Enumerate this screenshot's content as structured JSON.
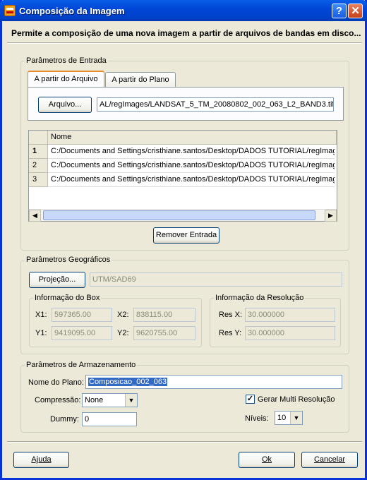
{
  "window": {
    "title": "Composição da Imagem",
    "help_glyph": "?",
    "close_glyph": "✕"
  },
  "description": "Permite a composição de uma nova imagem a partir de arquivos de bandas em disco...",
  "input": {
    "legend": "Parâmetros de Entrada",
    "tabs": [
      "A partir do Arquivo",
      "A partir do Plano"
    ],
    "file_button": "Arquivo...",
    "file_path": "AL/regImages/LANDSAT_5_TM_20080802_002_063_L2_BAND3.tif",
    "table_header": "Nome",
    "rows": [
      {
        "num": "1",
        "name": "C:/Documents and Settings/cristhiane.santos/Desktop/DADOS TUTORIAL/regImag"
      },
      {
        "num": "2",
        "name": "C:/Documents and Settings/cristhiane.santos/Desktop/DADOS TUTORIAL/regImag"
      },
      {
        "num": "3",
        "name": "C:/Documents and Settings/cristhiane.santos/Desktop/DADOS TUTORIAL/regImag"
      }
    ],
    "remove_button": "Remover Entrada"
  },
  "geo": {
    "legend": "Parâmetros Geográficos",
    "projection_button": "Projeção...",
    "projection_value": "UTM/SAD69",
    "box": {
      "legend": "Informação do Box",
      "x1_label": "X1:",
      "x1": "597365.00",
      "x2_label": "X2:",
      "x2": "838115.00",
      "y1_label": "Y1:",
      "y1": "9419095.00",
      "y2_label": "Y2:",
      "y2": "9620755.00"
    },
    "resolution": {
      "legend": "Informação da Resolução",
      "resx_label": "Res X:",
      "resx": "30.000000",
      "resy_label": "Res Y:",
      "resy": "30.000000"
    }
  },
  "storage": {
    "legend": "Parâmetros de Armazenamento",
    "plane_label": "Nome do Plano:",
    "plane_value": "Composicao_002_063",
    "compression_label": "Compressão:",
    "compression_value": "None",
    "dummy_label": "Dummy:",
    "dummy_value": "0",
    "multires_label": "Gerar Multi Resolução",
    "multires_checked": true,
    "levels_label": "Níveis:",
    "levels_value": "10"
  },
  "footer": {
    "help": "Ajuda",
    "ok": "Ok",
    "cancel": "Cancelar"
  }
}
